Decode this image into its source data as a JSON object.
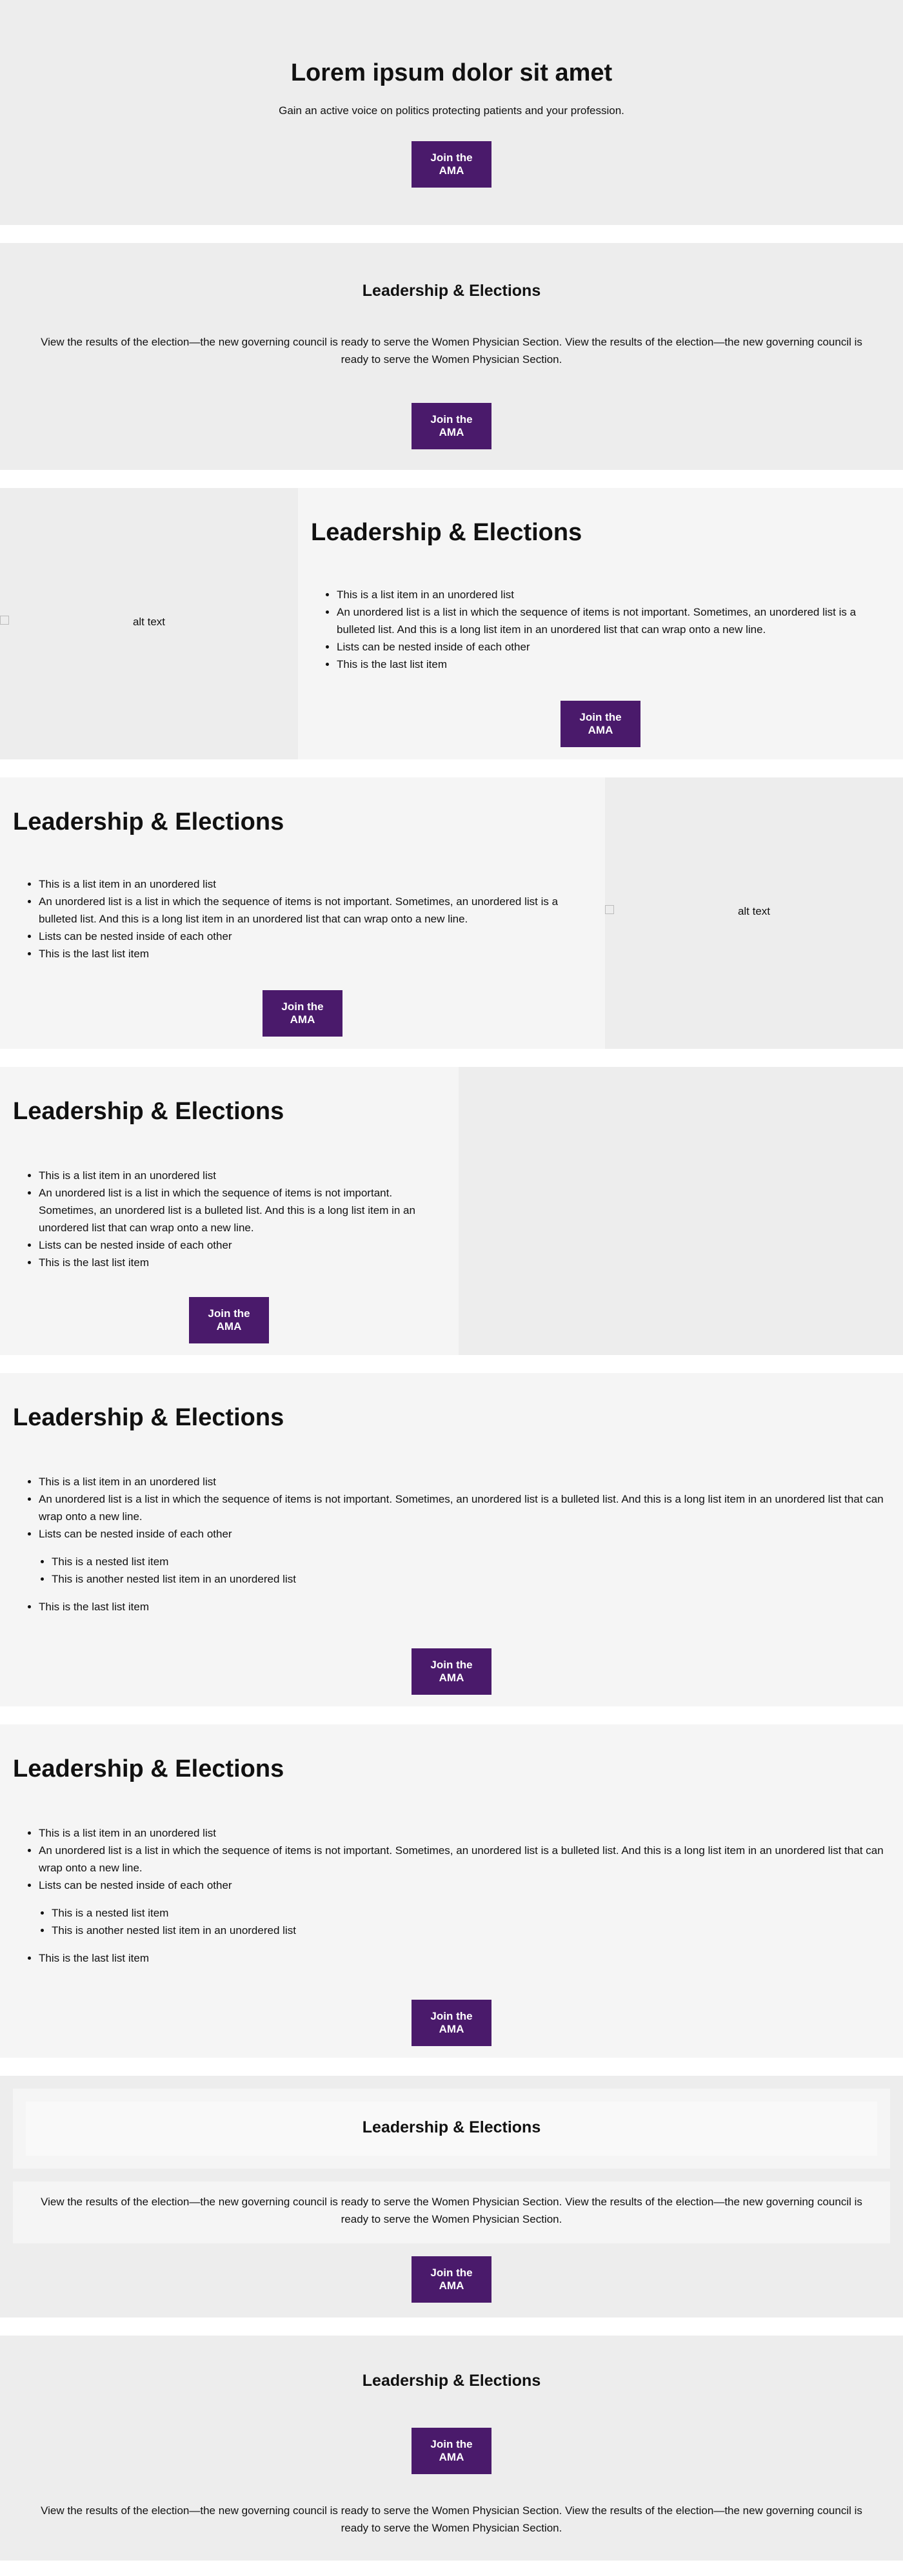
{
  "hero": {
    "title": "Lorem ipsum dolor sit amet",
    "subtitle": "Gain an active voice on politics protecting patients and your profession.",
    "button_label": "Join the AMA"
  },
  "centered_section": {
    "title": "Leadership & Elections",
    "body": "View the results of the election—the new governing council is ready to serve the Women Physician Section. View the results of the election—the new governing council is ready to serve the Women Physician Section.",
    "button_label": "Join the AMA"
  },
  "image_left_section": {
    "image_alt": "alt text",
    "title": "Leadership & Elections",
    "items": [
      "This is a list item in an unordered list",
      "An unordered list is a list in which the sequence of items is not important. Sometimes, an unordered list is a bulleted list. And this is a long list item in an unordered list that can wrap onto a new line.",
      "Lists can be nested inside of each other",
      "This is the last list item"
    ],
    "button_label": "Join the AMA"
  },
  "image_right_section": {
    "image_alt": "alt text",
    "title": "Leadership & Elections",
    "items": [
      "This is a list item in an unordered list",
      "An unordered list is a list in which the sequence of items is not important. Sometimes, an unordered list is a bulleted list. And this is a long list item in an unordered list that can wrap onto a new line.",
      "Lists can be nested inside of each other",
      "This is the last list item"
    ],
    "button_label": "Join the AMA"
  },
  "half_section": {
    "title": "Leadership & Elections",
    "items": [
      "This is a list item in an unordered list",
      "An unordered list is a list in which the sequence of items is not important. Sometimes, an unordered list is a bulleted list. And this is a long list item in an unordered list that can wrap onto a new line.",
      "Lists can be nested inside of each other",
      "This is the last list item"
    ],
    "button_label": "Join the AMA"
  },
  "nested_section_1": {
    "title": "Leadership & Elections",
    "items": [
      "This is a list item in an unordered list",
      "An unordered list is a list in which the sequence of items is not important. Sometimes, an unordered list is a bulleted list. And this is a long list item in an unordered list that can wrap onto a new line.",
      "Lists can be nested inside of each other",
      "This is the last list item"
    ],
    "nested_items": [
      "This is a nested list item",
      "This is another nested list item in an unordered list"
    ],
    "button_label": "Join the AMA"
  },
  "nested_section_2": {
    "title": "Leadership & Elections",
    "items": [
      "This is a list item in an unordered list",
      "An unordered list is a list in which the sequence of items is not important. Sometimes, an unordered list is a bulleted list. And this is a long list item in an unordered list that can wrap onto a new line.",
      "Lists can be nested inside of each other",
      "This is the last list item"
    ],
    "nested_items": [
      "This is a nested list item",
      "This is another nested list item in an unordered list"
    ],
    "button_label": "Join the AMA"
  },
  "boxed_section": {
    "title": "Leadership & Elections",
    "body": "View the results of the election—the new governing council is ready to serve the Women Physician Section. View the results of the election—the new governing council is ready to serve the Women Physician Section.",
    "button_label": "Join the AMA"
  },
  "button_first_section": {
    "title": "Leadership & Elections",
    "button_label": "Join the AMA",
    "body": "View the results of the election—the new governing council is ready to serve the Women Physician Section. View the results of the election—the new governing council is ready to serve the Women Physician Section."
  },
  "colors": {
    "button_bg": "#4a1a6b",
    "panel_gray": "#ededed",
    "panel_light": "#f5f5f5"
  }
}
